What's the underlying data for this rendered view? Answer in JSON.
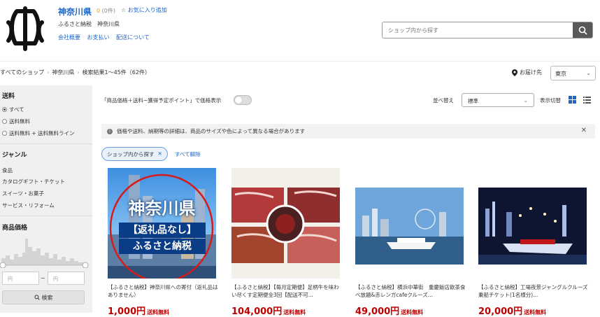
{
  "header": {
    "shop_name": "神奈川県",
    "rating_count": "0",
    "rating_suffix": "(0件)",
    "favorite": "お気に入り追加",
    "subtitle": "ふるさと納税　神奈川県",
    "links": [
      "会社概要",
      "お支払い",
      "配送について"
    ],
    "search_placeholder": "ショップ内から探す"
  },
  "breadcrumb": [
    "すべてのショップ",
    "神奈川県",
    "検索結果1～45件（62件）"
  ],
  "delivery": {
    "label": "お届け先",
    "region": "東京"
  },
  "sidebar": {
    "shipping_heading": "送料",
    "shipping_options": [
      "すべて",
      "送料無料",
      "送料無料 + 送料無料ライン"
    ],
    "genre_heading": "ジャンル",
    "genres": [
      "食品",
      "カタログギフト・チケット",
      "スイーツ・お菓子",
      "サービス・リフォーム"
    ],
    "price_heading": "商品価格",
    "price_min": "円",
    "price_sep": "~",
    "price_max": "円",
    "search_button": "検索"
  },
  "toolbar": {
    "tax_label": "「商品価格＋送料−獲得予定ポイント」で価格表示",
    "sort_label": "並べ替え",
    "sort_value": "標準",
    "view_label": "表示切替"
  },
  "notice": "価格や送料、納期等の詳細は、商品のサイズや色によって異なる場合があります",
  "filter_chip": "ショップ内から探す",
  "clear_all": "すべて解除",
  "products": [
    {
      "image_lines": [
        "神奈川県",
        "【返礼品なし】",
        "ふるさと納税"
      ],
      "title": "【ふるさと納税】神奈川県への寄付（返礼品はありません）",
      "price": "1,000円",
      "shipping": "送料無料"
    },
    {
      "title": "【ふるさと納税】【毎月定期便】足柄牛を味わい尽くす定期便全3回【配送不可...",
      "price": "104,000円",
      "shipping": "送料無料"
    },
    {
      "title": "【ふるさと納税】横浜中華街　重慶飯店飲茶食べ放題&赤レンガcafeクルーズ...",
      "price": "49,000円",
      "shipping": "送料無料"
    },
    {
      "title": "【ふるさと納税】工場夜景ジャングルクルーズ乗船チケット(1名様分)...",
      "price": "20,000円",
      "shipping": "送料無料"
    }
  ],
  "colors": {
    "link": "#1a66c9",
    "price": "#bf0000",
    "sidebar_bg": "#f0f0f0"
  }
}
